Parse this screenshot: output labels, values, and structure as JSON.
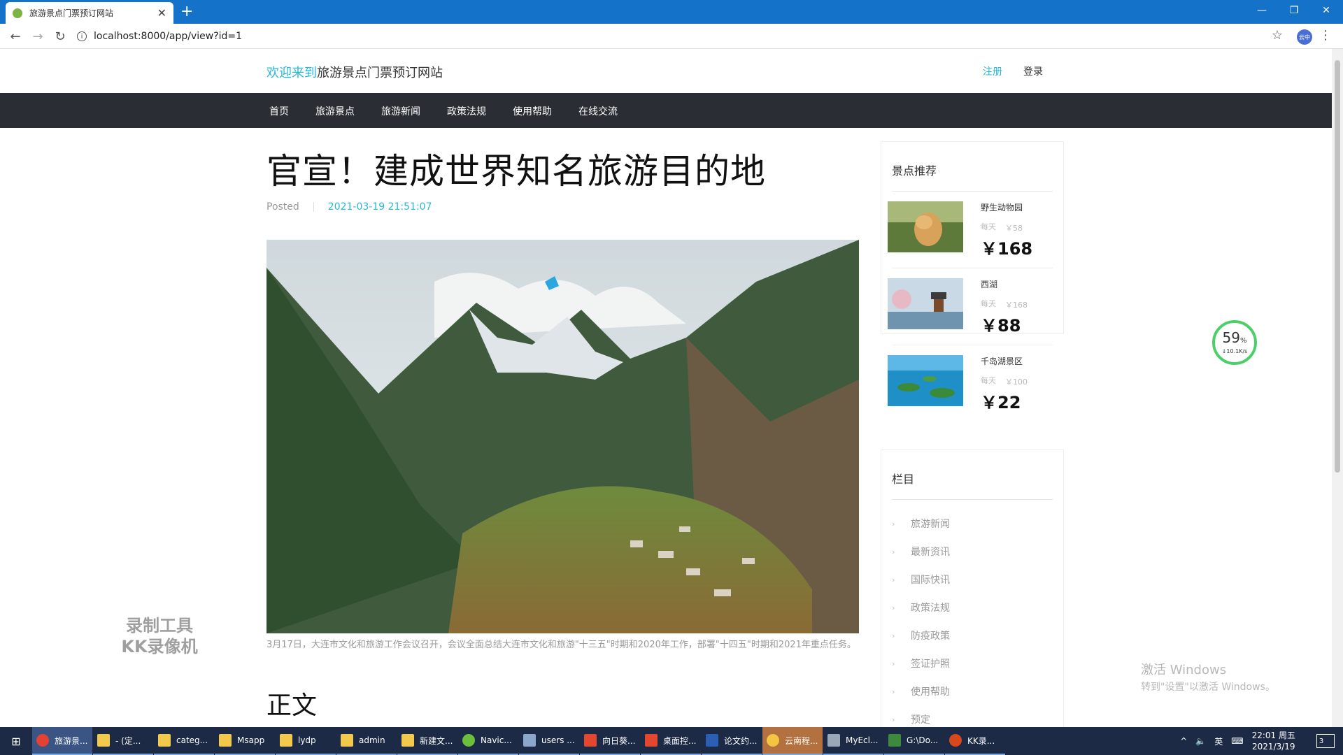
{
  "browser": {
    "tab_title": "旅游景点门票预订网站",
    "url": "localhost:8000/app/view?id=1",
    "profile_label": "云中"
  },
  "site": {
    "brand_highlight": "欢迎来到",
    "brand_name": "旅游景点门票预订网站",
    "register": "注册",
    "login": "登录",
    "nav": [
      "首页",
      "旅游景点",
      "旅游新闻",
      "政策法规",
      "使用帮助",
      "在线交流"
    ]
  },
  "article": {
    "title": "官宣！建成世界知名旅游目的地",
    "posted_label": "Posted",
    "date": "2021-03-19 21:51:07",
    "caption": "3月17日，大连市文化和旅游工作会议召开，会议全面总结大连市文化和旅游\"十三五\"时期和2020年工作，部署\"十四五\"时期和2021年重点任务。",
    "section_heading": "正文"
  },
  "sidebar": {
    "recommend_title": "景点推荐",
    "spots": [
      {
        "name": "野生动物园",
        "daily": "每天",
        "orig_price": "￥58",
        "price": "￥168"
      },
      {
        "name": "西湖",
        "daily": "每天",
        "orig_price": "￥168",
        "price": "￥88"
      },
      {
        "name": "千岛湖景区",
        "daily": "每天",
        "orig_price": "￥100",
        "price": "￥22"
      }
    ],
    "category_title": "栏目",
    "categories": [
      "旅游新闻",
      "最新资讯",
      "国际快讯",
      "政策法规",
      "防疫政策",
      "签证护照",
      "使用帮助",
      "预定"
    ]
  },
  "overlays": {
    "speed_pct": "59",
    "speed_unit": "%",
    "speed_rate": "↓10.1K/s",
    "watermark_line1": "录制工具",
    "watermark_line2": "KK录像机",
    "activate_line1": "激活 Windows",
    "activate_line2": "转到\"设置\"以激活 Windows。"
  },
  "taskbar": {
    "items": [
      "旅游景...",
      "- (定...",
      "categ...",
      "Msapp",
      "lydp",
      "admin",
      "新建文...",
      "Navic...",
      "users ...",
      "向日葵...",
      "桌面控...",
      "论文约...",
      "云南程...",
      "MyEcl...",
      "G:\\Do...",
      "KK录..."
    ],
    "ime": "英",
    "time": "22:01 周五",
    "date": "2021/3/19",
    "notif_count": "3"
  },
  "colors": {
    "accent": "#27b8d6",
    "nav_bg": "#2a2e34",
    "titlebar": "#1473c8",
    "taskbar": "#1c2a45"
  }
}
